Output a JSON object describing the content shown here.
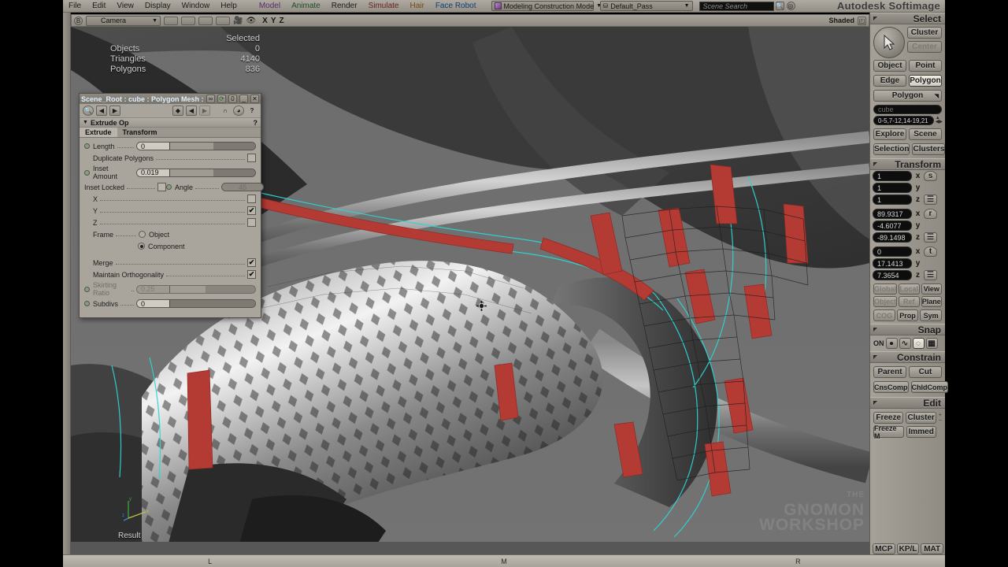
{
  "app": {
    "brand": "Autodesk Softimage"
  },
  "menubar": {
    "left_items": [
      "File",
      "Edit",
      "View",
      "Display",
      "Window",
      "Help"
    ],
    "module_items": [
      "Model",
      "Animate",
      "Render",
      "Simulate",
      "Hair",
      "Face Robot"
    ],
    "construction_mode": "Modeling Construction Mode",
    "pass": "Default_Pass",
    "search_placeholder": "Scene Search",
    "search_value": ""
  },
  "view_toolbar": {
    "camera_label": "Camera",
    "axis_labels": [
      "X",
      "Y",
      "Z"
    ],
    "display_mode": "Shaded",
    "icons": [
      "camera-icon",
      "eye-icon",
      "maximize-icon"
    ]
  },
  "viewport": {
    "stats_header": "Selected",
    "stats": [
      {
        "label": "Objects",
        "value": "0"
      },
      {
        "label": "Triangles",
        "value": "4140"
      },
      {
        "label": "Polygons",
        "value": "836"
      }
    ],
    "result_label": "Result",
    "gizmo_axes": [
      "x",
      "y",
      "z"
    ],
    "watermark_small": "THE",
    "watermark_line1": "GNOMON",
    "watermark_line2": "WORKSHOP"
  },
  "ppg": {
    "title": "Scene_Root : cube : Polygon Mesh : ...",
    "title_buttons": [
      "link-icon",
      "refresh-icon",
      "info-icon",
      "minimize-icon",
      "close-icon"
    ],
    "toolbar_icons": [
      "inspect-icon",
      "prev-icon",
      "next-icon",
      "anim-prev-icon",
      "anim-cur-icon",
      "anim-next-icon",
      "snap-icon",
      "key-icon",
      "help-icon"
    ],
    "op_name": "Extrude Op",
    "tabs": [
      {
        "label": "Extrude",
        "selected": true
      },
      {
        "label": "Transform",
        "selected": false
      }
    ],
    "params": {
      "length_label": "Length",
      "length_value": "0",
      "duplicate_label": "Duplicate Polygons",
      "duplicate_checked": false,
      "inset_label": "Inset",
      "inset_label2": "Amount",
      "inset_value": "0.019",
      "inset_locked_label": "Inset Locked",
      "inset_locked_checked": false,
      "angle_label": "Angle",
      "angle_value": "45",
      "axis_x_label": "X",
      "axis_x_checked": false,
      "axis_y_label": "Y",
      "axis_y_checked": true,
      "axis_z_label": "Z",
      "axis_z_checked": false,
      "frame_label": "Frame",
      "frame_object": "Object",
      "frame_component": "Component",
      "frame_selected": "Component",
      "merge_label": "Merge",
      "merge_checked": true,
      "ortho_label": "Maintain Orthogonality",
      "ortho_checked": true,
      "skirting_label": "Skirting",
      "skirting_label2": "Ratio",
      "skirting_value": "0.25",
      "subdivs_label": "Subdivs",
      "subdivs_value": "0"
    }
  },
  "sidebar": {
    "select": {
      "header": "Select",
      "cursor_icon": "arrow-cursor-icon",
      "cluster": "Cluster",
      "center": "Center",
      "object": "Object",
      "point": "Point",
      "edge": "Edge",
      "polygon": "Polygon",
      "polygon_menu": "Polygon",
      "active": "Polygon"
    },
    "explorer": {
      "object_name": "cube",
      "component_range": "0-5,7-12,14-19,21",
      "explore": "Explore",
      "scene": "Scene",
      "selection": "Selection",
      "clusters": "Clusters"
    },
    "transform": {
      "header": "Transform",
      "scale": {
        "x": "1",
        "y": "1",
        "z": "1",
        "icon": "s"
      },
      "rotate": {
        "x": "89.9317",
        "y": "-4.6077",
        "z": "-89.1498",
        "icon": "r"
      },
      "translate": {
        "x": "0",
        "y": "17.1413",
        "z": "7.3654",
        "icon": "t"
      },
      "ref_row1": [
        "Global",
        "Local",
        "View"
      ],
      "ref_row1_active": "View",
      "ref_row2": [
        "Object",
        "Ref",
        "Plane"
      ],
      "ref_row2_active": "Plane",
      "ref_row3": [
        "COG",
        "Prop",
        "Sym"
      ],
      "axis_labels": [
        "x",
        "y",
        "z"
      ]
    },
    "snap": {
      "header": "Snap",
      "on_label": "ON",
      "icons": [
        "point-snap-icon",
        "curve-snap-icon",
        "object-snap-icon",
        "grid-snap-icon"
      ],
      "active_icon": "object-snap-icon"
    },
    "constrain": {
      "header": "Constrain",
      "buttons": [
        "Parent",
        "Cut",
        "CnsComp",
        "ChldComp"
      ]
    },
    "edit": {
      "header": "Edit",
      "buttons": [
        "Freeze",
        "Cluster",
        "Freeze M",
        "Immed"
      ]
    },
    "bottom_tabs": [
      "MCP",
      "KP/L",
      "MAT"
    ]
  },
  "statusbar": {
    "markers": [
      "L",
      "M",
      "R"
    ]
  },
  "colors": {
    "panel": "#a9a59d",
    "panel_dark": "#8f8b83",
    "viewport_bg": "#6e6e6e",
    "selection_red": "#b43a34",
    "selection_cyan": "#2fd4d4",
    "title_text": "#dfeffa"
  }
}
